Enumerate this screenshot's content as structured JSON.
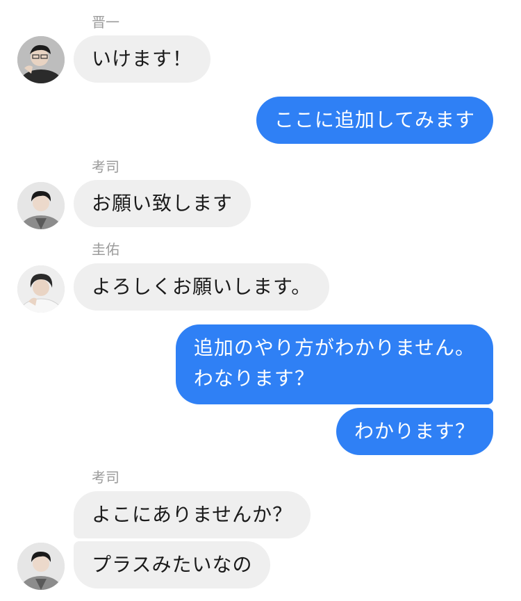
{
  "colors": {
    "outgoing_bubble": "#2f80f5",
    "incoming_bubble": "#efefef",
    "sender_name": "#9b9b9b",
    "background": "#ffffff"
  },
  "messages": [
    {
      "direction": "incoming",
      "sender": "晋一",
      "text": "いけます！",
      "avatar": "avatar-shinichi"
    },
    {
      "direction": "outgoing",
      "text": "ここに追加してみます"
    },
    {
      "direction": "incoming",
      "sender": "考司",
      "text": "お願い致します",
      "avatar": "avatar-koji"
    },
    {
      "direction": "incoming",
      "sender": "圭佑",
      "text": "よろしくお願いします。",
      "avatar": "avatar-keisuke"
    },
    {
      "direction": "outgoing",
      "lines": [
        "追加のやり方がわかりません。",
        "わなります？"
      ]
    },
    {
      "direction": "outgoing",
      "text": "わかります？"
    },
    {
      "direction": "incoming",
      "sender": "考司",
      "text": "よこにありませんか？"
    },
    {
      "direction": "incoming",
      "text": "プラスみたいなの",
      "avatar": "avatar-koji"
    }
  ]
}
